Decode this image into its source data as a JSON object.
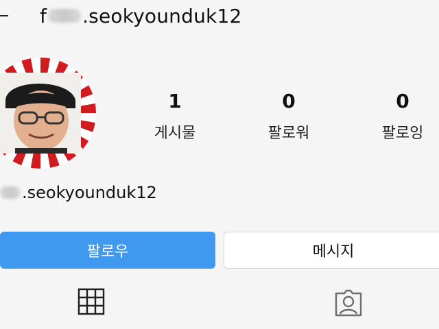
{
  "header": {
    "username_prefix": "f",
    "username_suffix": ".seokyounduk12"
  },
  "profile": {
    "display_username": ".seokyounduk12"
  },
  "stats": [
    {
      "value": "1",
      "label": "게시물"
    },
    {
      "value": "0",
      "label": "팔로워"
    },
    {
      "value": "0",
      "label": "팔로잉"
    }
  ],
  "actions": {
    "follow_label": "팔로우",
    "message_label": "메시지"
  },
  "colors": {
    "follow_button": "#3f99ee",
    "avatar_ring_red": "#d01c20",
    "background": "#f5f5f5"
  },
  "icons": {
    "posts_tab": "grid-icon",
    "tagged_tab": "tagged-person-icon"
  }
}
